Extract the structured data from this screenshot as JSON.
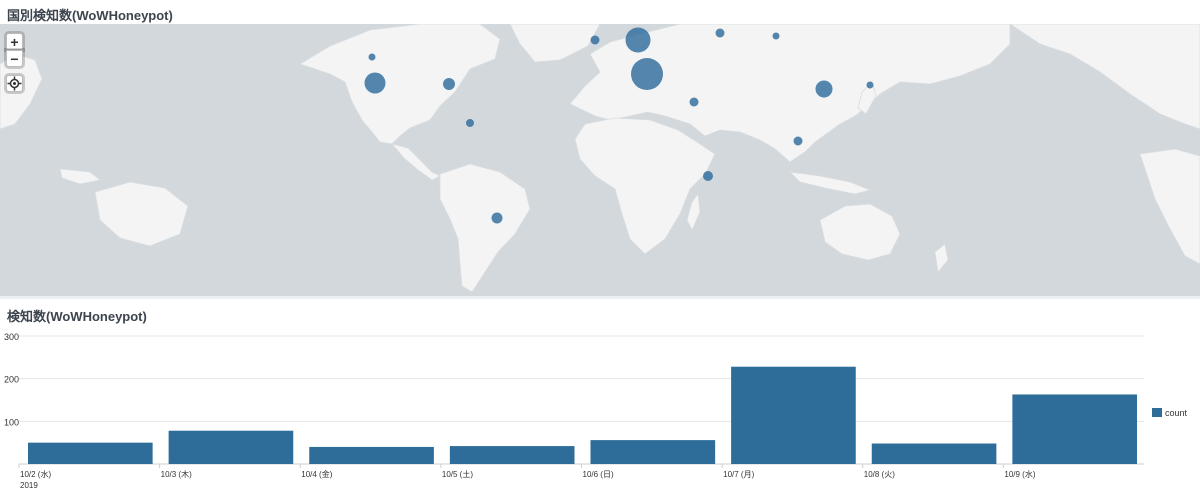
{
  "map_panel": {
    "title": "国別検知数(WoWHoneypot)",
    "controls": {
      "zoom_in": "+",
      "zoom_out": "−"
    },
    "colors": {
      "ocean": "#d3d8dc",
      "land": "#f4f4f4",
      "border": "#d8dcdf",
      "bubble": "#2f6d9e"
    }
  },
  "bar_panel": {
    "title": "検知数(WoWHoneypot)"
  },
  "chart_data": {
    "type": "bar",
    "title": "検知数(WoWHoneypot)",
    "categories": [
      "10/2 (水)",
      "10/3 (木)",
      "10/4 (金)",
      "10/5 (土)",
      "10/6 (日)",
      "10/7 (月)",
      "10/8 (火)",
      "10/9 (水)"
    ],
    "year_label": "2019",
    "series": [
      {
        "name": "count",
        "values": [
          50,
          78,
          40,
          42,
          56,
          228,
          48,
          163
        ],
        "color": "#2e6c99"
      }
    ],
    "yticks": [
      100,
      200,
      300
    ],
    "ylim": [
      0,
      300
    ],
    "grid": true,
    "legend": "right"
  }
}
